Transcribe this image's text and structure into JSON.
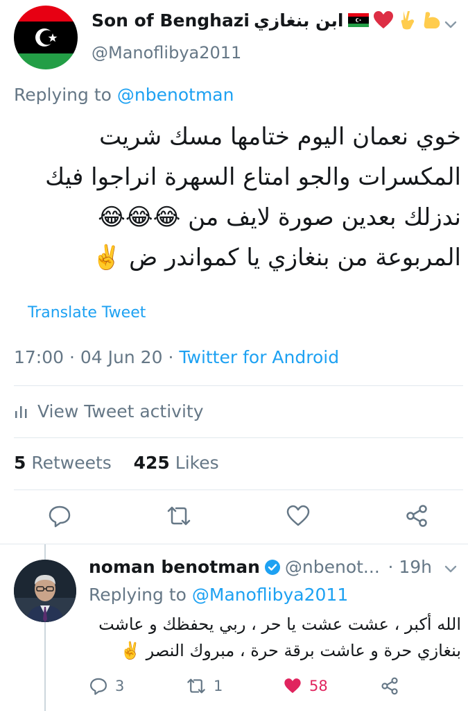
{
  "main_tweet": {
    "display_name": "Son of Benghazi",
    "display_name_arabic": "ابن بنغازي",
    "name_emojis": [
      "libya-flag",
      "red-heart",
      "victory-hand",
      "flexed-biceps"
    ],
    "handle": "@Manoflibya2011",
    "replying_prefix": "Replying to",
    "replying_to": "@nbenotman",
    "text_lines": [
      "خوي نعمان اليوم ختامها مسك شريت",
      "المكسرات والجو امتاع السهرة انراجوا فيك",
      "ندزلك بعدين صورة لايف من 😂😂😂",
      "المربوعة من بنغازي يا كمواندر ض ✌️"
    ],
    "translate_label": "Translate Tweet",
    "time": "17:00",
    "date": "04 Jun 20",
    "source": "Twitter for Android",
    "activity_label": "View Tweet activity",
    "retweets_count": "5",
    "retweets_label": "Retweets",
    "likes_count": "425",
    "likes_label": "Likes"
  },
  "reply": {
    "display_name": "noman benotman",
    "verified": true,
    "handle": "@nbenot...",
    "time": "· 19h",
    "replying_prefix": "Replying to",
    "replying_to": "@Manoflibya2011",
    "text_lines": [
      "الله أكبر ، عشت عشت يا حر ، ربي يحفظك و عاشت",
      "بنغازي حرة و عاشت برقة حرة ، مبروك النصر ✌️"
    ],
    "reply_count": "3",
    "retweet_count": "1",
    "like_count": "58"
  },
  "colors": {
    "accent": "#1da1f2",
    "secondary_text": "#657786",
    "like": "#e0245e"
  }
}
